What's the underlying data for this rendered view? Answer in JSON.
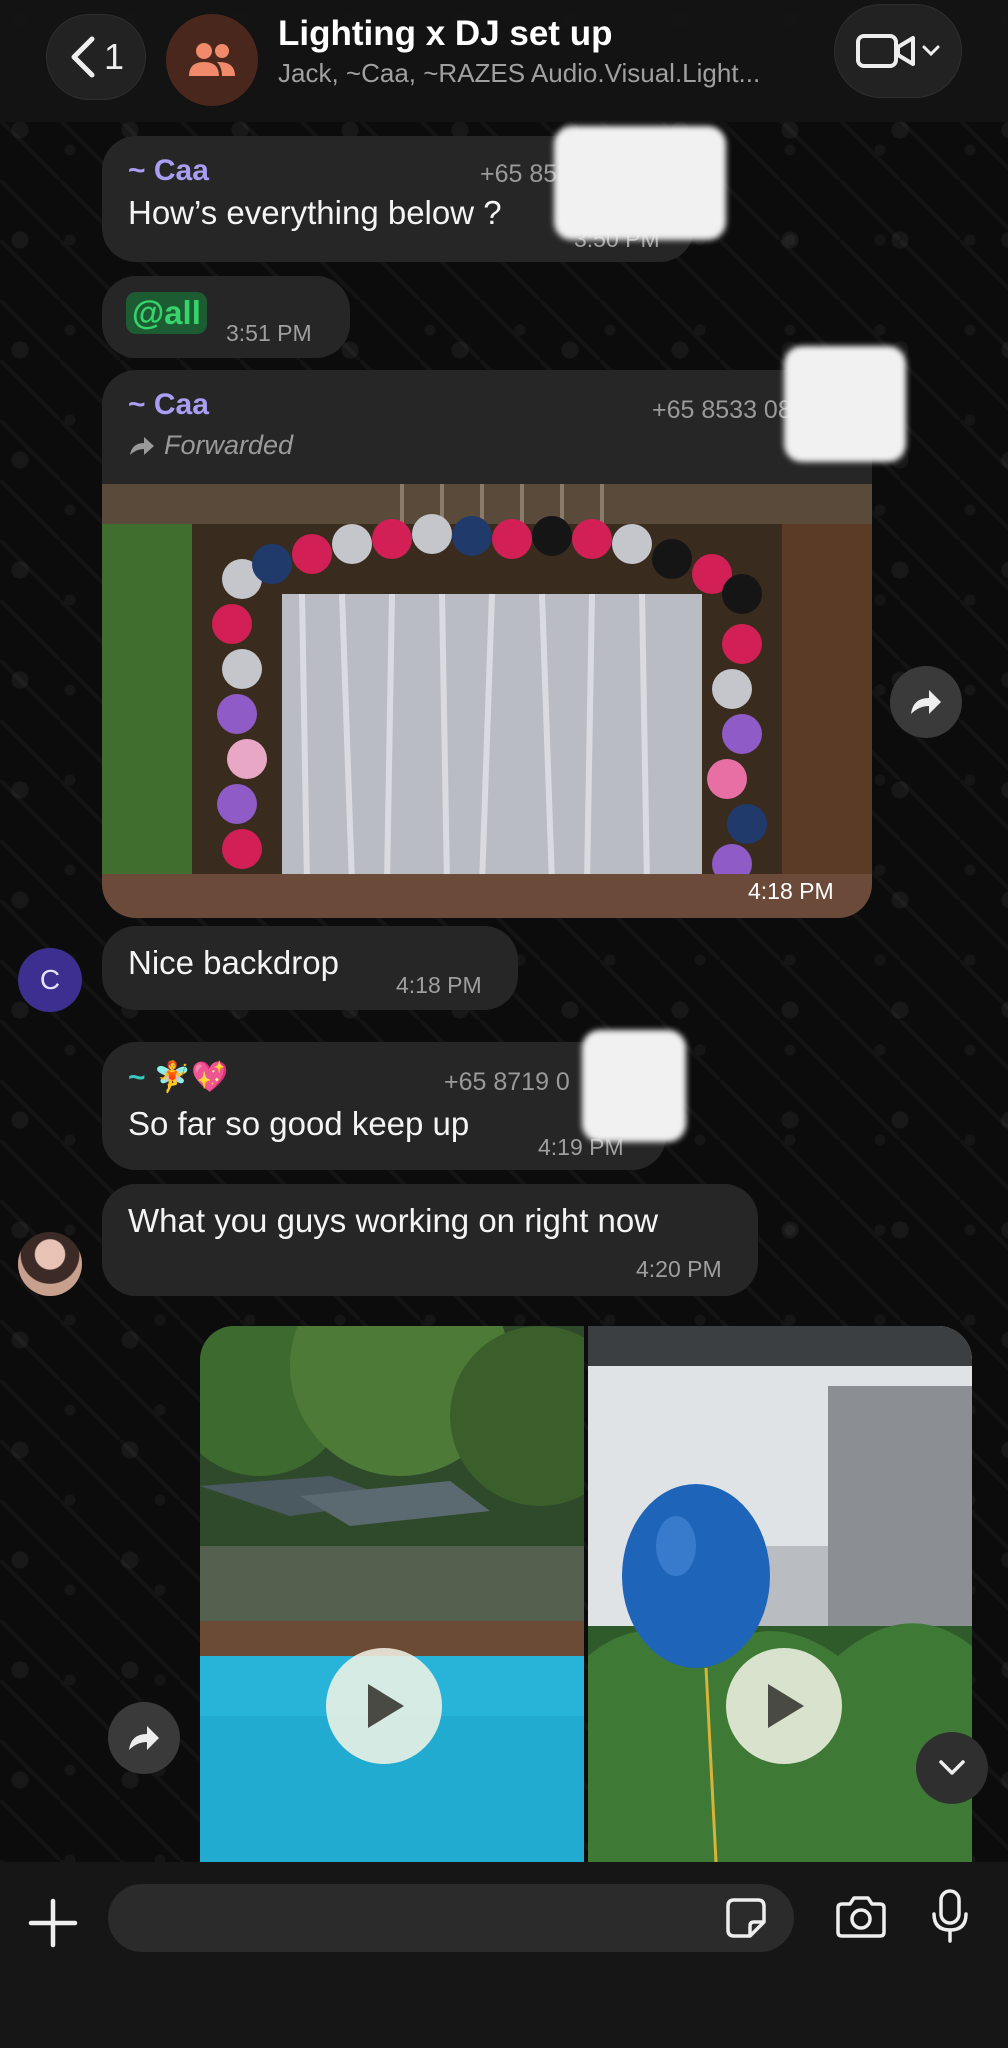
{
  "header": {
    "back_count": "1",
    "title": "Lighting x DJ set up",
    "subtitle": "Jack, ~Caa, ~RAZES Audio.Visual.Light..."
  },
  "messages": [
    {
      "sender": "~ Caa",
      "phone": "+65 8533 0864",
      "text": "How’s everything below ?",
      "time": "3:50 PM"
    },
    {
      "mention": "@all",
      "time": "3:51 PM"
    },
    {
      "sender": "~ Caa",
      "phone": "+65 8533 0864",
      "forwarded_label": "Forwarded",
      "time": "4:18 PM"
    },
    {
      "avatar_letter": "C",
      "text": "Nice backdrop",
      "time": "4:18 PM"
    },
    {
      "sender": "~ 🧚💖",
      "phone": "+65 8719 0",
      "text": "So far so good keep up",
      "time": "4:19 PM"
    },
    {
      "text": "What you guys working on right now",
      "time": "4:20 PM"
    }
  ],
  "input": {
    "placeholder": ""
  },
  "colors": {
    "sender_name": "#a99df4",
    "mention_text": "#37d36c",
    "bubble": "#262626"
  }
}
